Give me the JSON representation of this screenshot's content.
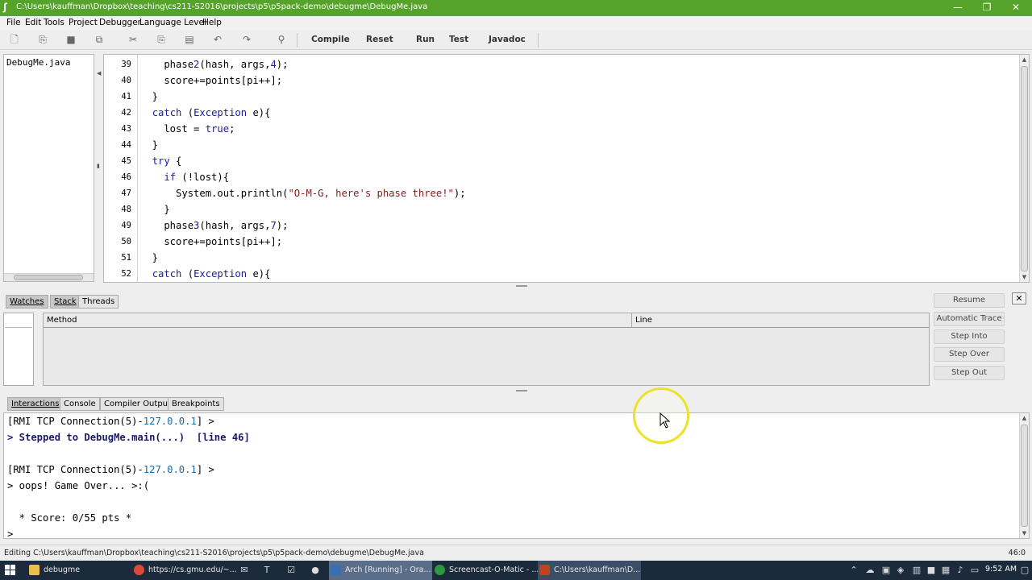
{
  "window": {
    "title": "C:\\Users\\kauffman\\Dropbox\\teaching\\cs211-S2016\\projects\\p5\\p5pack-demo\\debugme\\DebugMe.java",
    "controls": {
      "minimize": "—",
      "maximize": "❐",
      "close": "✕"
    }
  },
  "menu": {
    "items": [
      {
        "label": "File"
      },
      {
        "label": "Edit"
      },
      {
        "label": "Tools"
      },
      {
        "label": "Project"
      },
      {
        "label": "Debugger"
      },
      {
        "label": "Language Level"
      },
      {
        "label": "Help"
      }
    ]
  },
  "toolbar": {
    "icons": [
      "new-file-icon",
      "open-icon",
      "save-icon",
      "save-all-icon",
      "cut-icon",
      "copy-icon",
      "paste-icon",
      "undo-icon",
      "redo-icon",
      "find-icon"
    ],
    "buttons": [
      "Compile",
      "Reset",
      "Run",
      "Test",
      "Javadoc"
    ]
  },
  "files": {
    "items": [
      "DebugMe.java"
    ]
  },
  "editor": {
    "lines": [
      {
        "n": "39",
        "indent": "    ",
        "text": "phase2(hash, args,4);"
      },
      {
        "n": "40",
        "indent": "    ",
        "text": "score+=points[pi++];"
      },
      {
        "n": "41",
        "indent": "  ",
        "text": "}"
      },
      {
        "n": "42",
        "indent": "  ",
        "text": "catch (Exception e){"
      },
      {
        "n": "43",
        "indent": "    ",
        "text": "lost = true;"
      },
      {
        "n": "44",
        "indent": "  ",
        "text": "}"
      },
      {
        "n": "45",
        "indent": "  ",
        "text": "try {"
      },
      {
        "n": "46",
        "indent": "    ",
        "text": "if (!lost){"
      },
      {
        "n": "47",
        "indent": "      ",
        "text": "System.out.println(\"O-M-G, here's phase three!\");"
      },
      {
        "n": "48",
        "indent": "    ",
        "text": "}"
      },
      {
        "n": "49",
        "indent": "    ",
        "text": "phase3(hash, args,7);"
      },
      {
        "n": "50",
        "indent": "    ",
        "text": "score+=points[pi++];"
      },
      {
        "n": "51",
        "indent": "  ",
        "text": "}"
      },
      {
        "n": "52",
        "indent": "  ",
        "text": "catch (Exception e){"
      }
    ]
  },
  "debugger": {
    "tabs": {
      "watches": "Watches",
      "stack": "Stack",
      "threads": "Threads"
    },
    "table": {
      "columns": [
        "Method",
        "Line"
      ]
    },
    "buttons": {
      "resume": "Resume",
      "automatic_trace": "Automatic Trace",
      "step_into": "Step Into",
      "step_over": "Step Over",
      "step_out": "Step Out"
    },
    "close": "✕"
  },
  "bottom_tabs": [
    "Interactions",
    "Console",
    "Compiler Output",
    "Breakpoints"
  ],
  "interactions": {
    "lines": [
      {
        "pre": "[RMI TCP Connection(5)-",
        "num": "127.0.0.1",
        "post": "] >",
        "bold": false
      },
      {
        "pre": "> Stepped to DebugMe.main(...)  [line 46]",
        "num": "",
        "post": "",
        "bold": true
      },
      {
        "pre": "",
        "num": "",
        "post": "",
        "bold": false
      },
      {
        "pre": "[RMI TCP Connection(5)-",
        "num": "127.0.0.1",
        "post": "] >",
        "bold": false
      },
      {
        "pre": "> oops! Game Over... >:(",
        "num": "",
        "post": "",
        "bold": false
      },
      {
        "pre": "",
        "num": "",
        "post": "",
        "bold": false
      },
      {
        "pre": "  * Score: 0/55 pts *",
        "num": "",
        "post": "",
        "bold": false
      },
      {
        "pre": ">",
        "num": "",
        "post": "",
        "bold": false
      }
    ]
  },
  "status": {
    "message": "Editing C:\\Users\\kauffman\\Dropbox\\teaching\\cs211-S2016\\projects\\p5\\p5pack-demo\\debugme\\DebugMe.java",
    "position": "46:0"
  },
  "taskbar": {
    "items": [
      {
        "label": "debugme",
        "icon": "folder-icon",
        "color": "#e8c04a"
      },
      {
        "label": "https://cs.gmu.edu/~...",
        "icon": "chrome-icon",
        "color": "#d94a3a"
      },
      {
        "label": "Arch [Running] - Ora...",
        "icon": "virtualbox-icon",
        "color": "#3a6fb0"
      },
      {
        "label": "Screencast-O-Matic - ...",
        "icon": "screencast-icon",
        "color": "#2a9a3a"
      },
      {
        "label": "C:\\Users\\kauffman\\D...",
        "icon": "java-icon",
        "color": "#c04020"
      }
    ],
    "clock": "9:52 AM"
  },
  "colors": {
    "title_bar": "#55a32a",
    "keyword": "#1a1aa6",
    "string": "#8b1a1a",
    "cursor_ring": "#ece22a"
  }
}
